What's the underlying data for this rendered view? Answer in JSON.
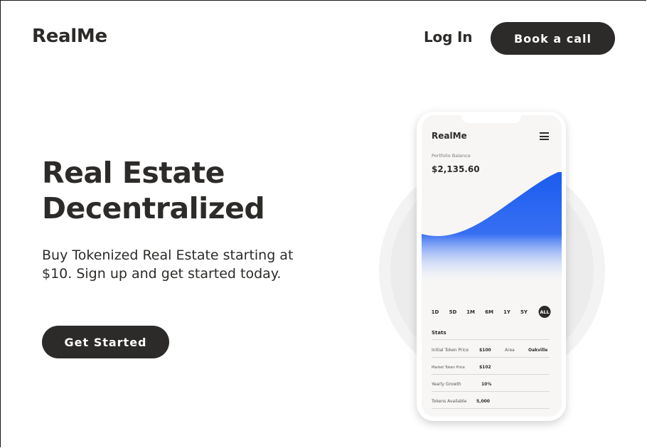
{
  "header": {
    "logo": "RealMe",
    "login_label": "Log In",
    "cta_label": "Book a call"
  },
  "hero": {
    "title_line1": "Real Estate",
    "title_line2": "Decentralized",
    "subtitle": "Buy Tokenized Real Estate starting at $10. Sign up and get started today.",
    "cta_label": "Get Started"
  },
  "phone": {
    "app_name": "RealMe",
    "menu_icon": "hamburger-menu-icon",
    "portfolio_label": "Portfolio Balance",
    "portfolio_value": "$2,135.60",
    "chart_color": "#1a5cf0",
    "ranges": [
      "1D",
      "5D",
      "1M",
      "6M",
      "1Y",
      "5Y",
      "ALL"
    ],
    "active_range": "ALL",
    "stats_title": "Stats",
    "stats": {
      "initial_price_label": "Initial Token Price",
      "initial_price_value": "$100",
      "area_label": "Area",
      "area_value": "Oakville",
      "market_price_label": "Market Token Price",
      "market_price_value": "$102",
      "yearly_growth_label": "Yearly Growth",
      "yearly_growth_value": "10%",
      "tokens_label": "Tokens Available",
      "tokens_value": "5,000"
    }
  },
  "colors": {
    "dark": "#2d2b29",
    "accent": "#1a5cf0",
    "background": "#ffffff"
  }
}
